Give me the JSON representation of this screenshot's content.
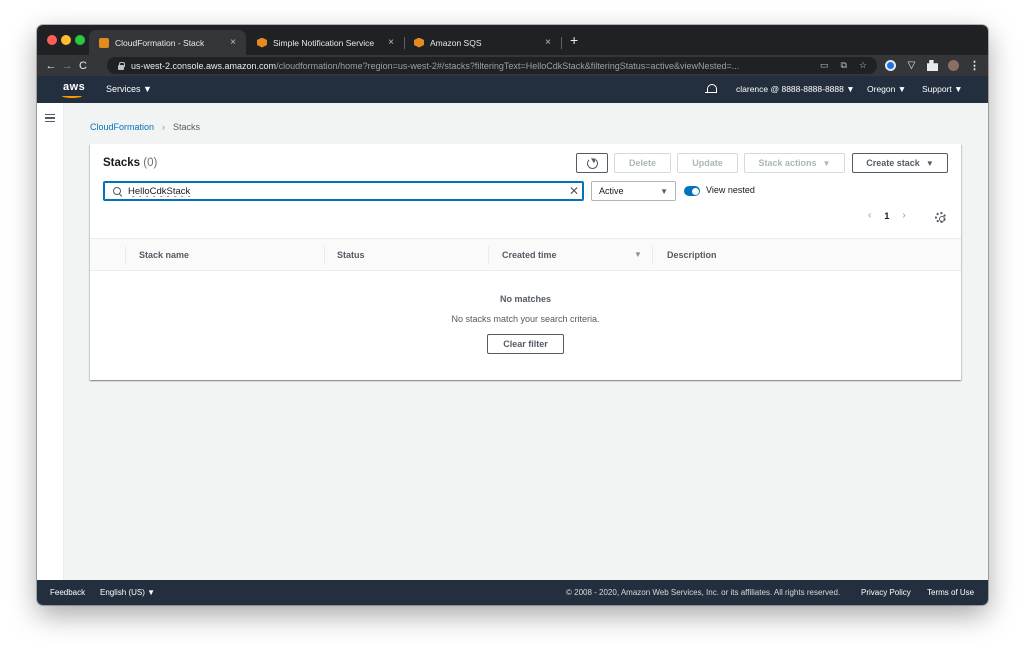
{
  "browser": {
    "tabs": [
      {
        "label": "CloudFormation - Stack",
        "close": "×"
      },
      {
        "label": "Simple Notification Service",
        "close": "×"
      },
      {
        "label": "Amazon SQS",
        "close": "×"
      }
    ],
    "new_tab": "+",
    "nav": {
      "back": "←",
      "forward": "→",
      "reload": "C"
    },
    "url_host": "us-west-2.console.aws.amazon.com",
    "url_path": "/cloudformation/home?region=us-west-2#/stacks?filteringText=HelloCdkStack&filteringStatus=active&viewNested=...",
    "omnibox_icons": [
      "▭",
      "⧉",
      "☆"
    ],
    "menu": "⋮"
  },
  "aws_header": {
    "logo": "aws",
    "services": "Services ▼",
    "account": "clarence @ 8888-8888-8888 ▼",
    "region": "Oregon ▼",
    "support": "Support ▼"
  },
  "breadcrumb": {
    "link": "CloudFormation",
    "separator": "›",
    "current": "Stacks"
  },
  "panel": {
    "title": "Stacks",
    "count": "(0)",
    "buttons": {
      "delete": "Delete",
      "update": "Update",
      "stack_actions": "Stack actions",
      "create_stack": "Create stack",
      "caret": "▼"
    },
    "search": {
      "value": "HelloCdkStack",
      "clear": "✕"
    },
    "status_filter": {
      "value": "Active",
      "caret": "▼"
    },
    "view_nested": {
      "label": "View nested",
      "enabled": true
    },
    "pager": {
      "prev": "‹",
      "page": "1",
      "next": "›"
    },
    "columns": [
      "Stack name",
      "Status",
      "Created time",
      "Description"
    ],
    "sort_caret": "▼",
    "empty": {
      "title": "No matches",
      "description": "No stacks match your search criteria.",
      "button": "Clear filter"
    }
  },
  "footer": {
    "feedback": "Feedback",
    "language": "English (US) ▼",
    "copyright": "© 2008 - 2020, Amazon Web Services, Inc. or its affiliates. All rights reserved.",
    "privacy": "Privacy Policy",
    "terms": "Terms of Use"
  },
  "colors": {
    "aws_nav": "#232f3e",
    "accent_blue": "#0073bb",
    "aws_orange": "#ff9900"
  }
}
